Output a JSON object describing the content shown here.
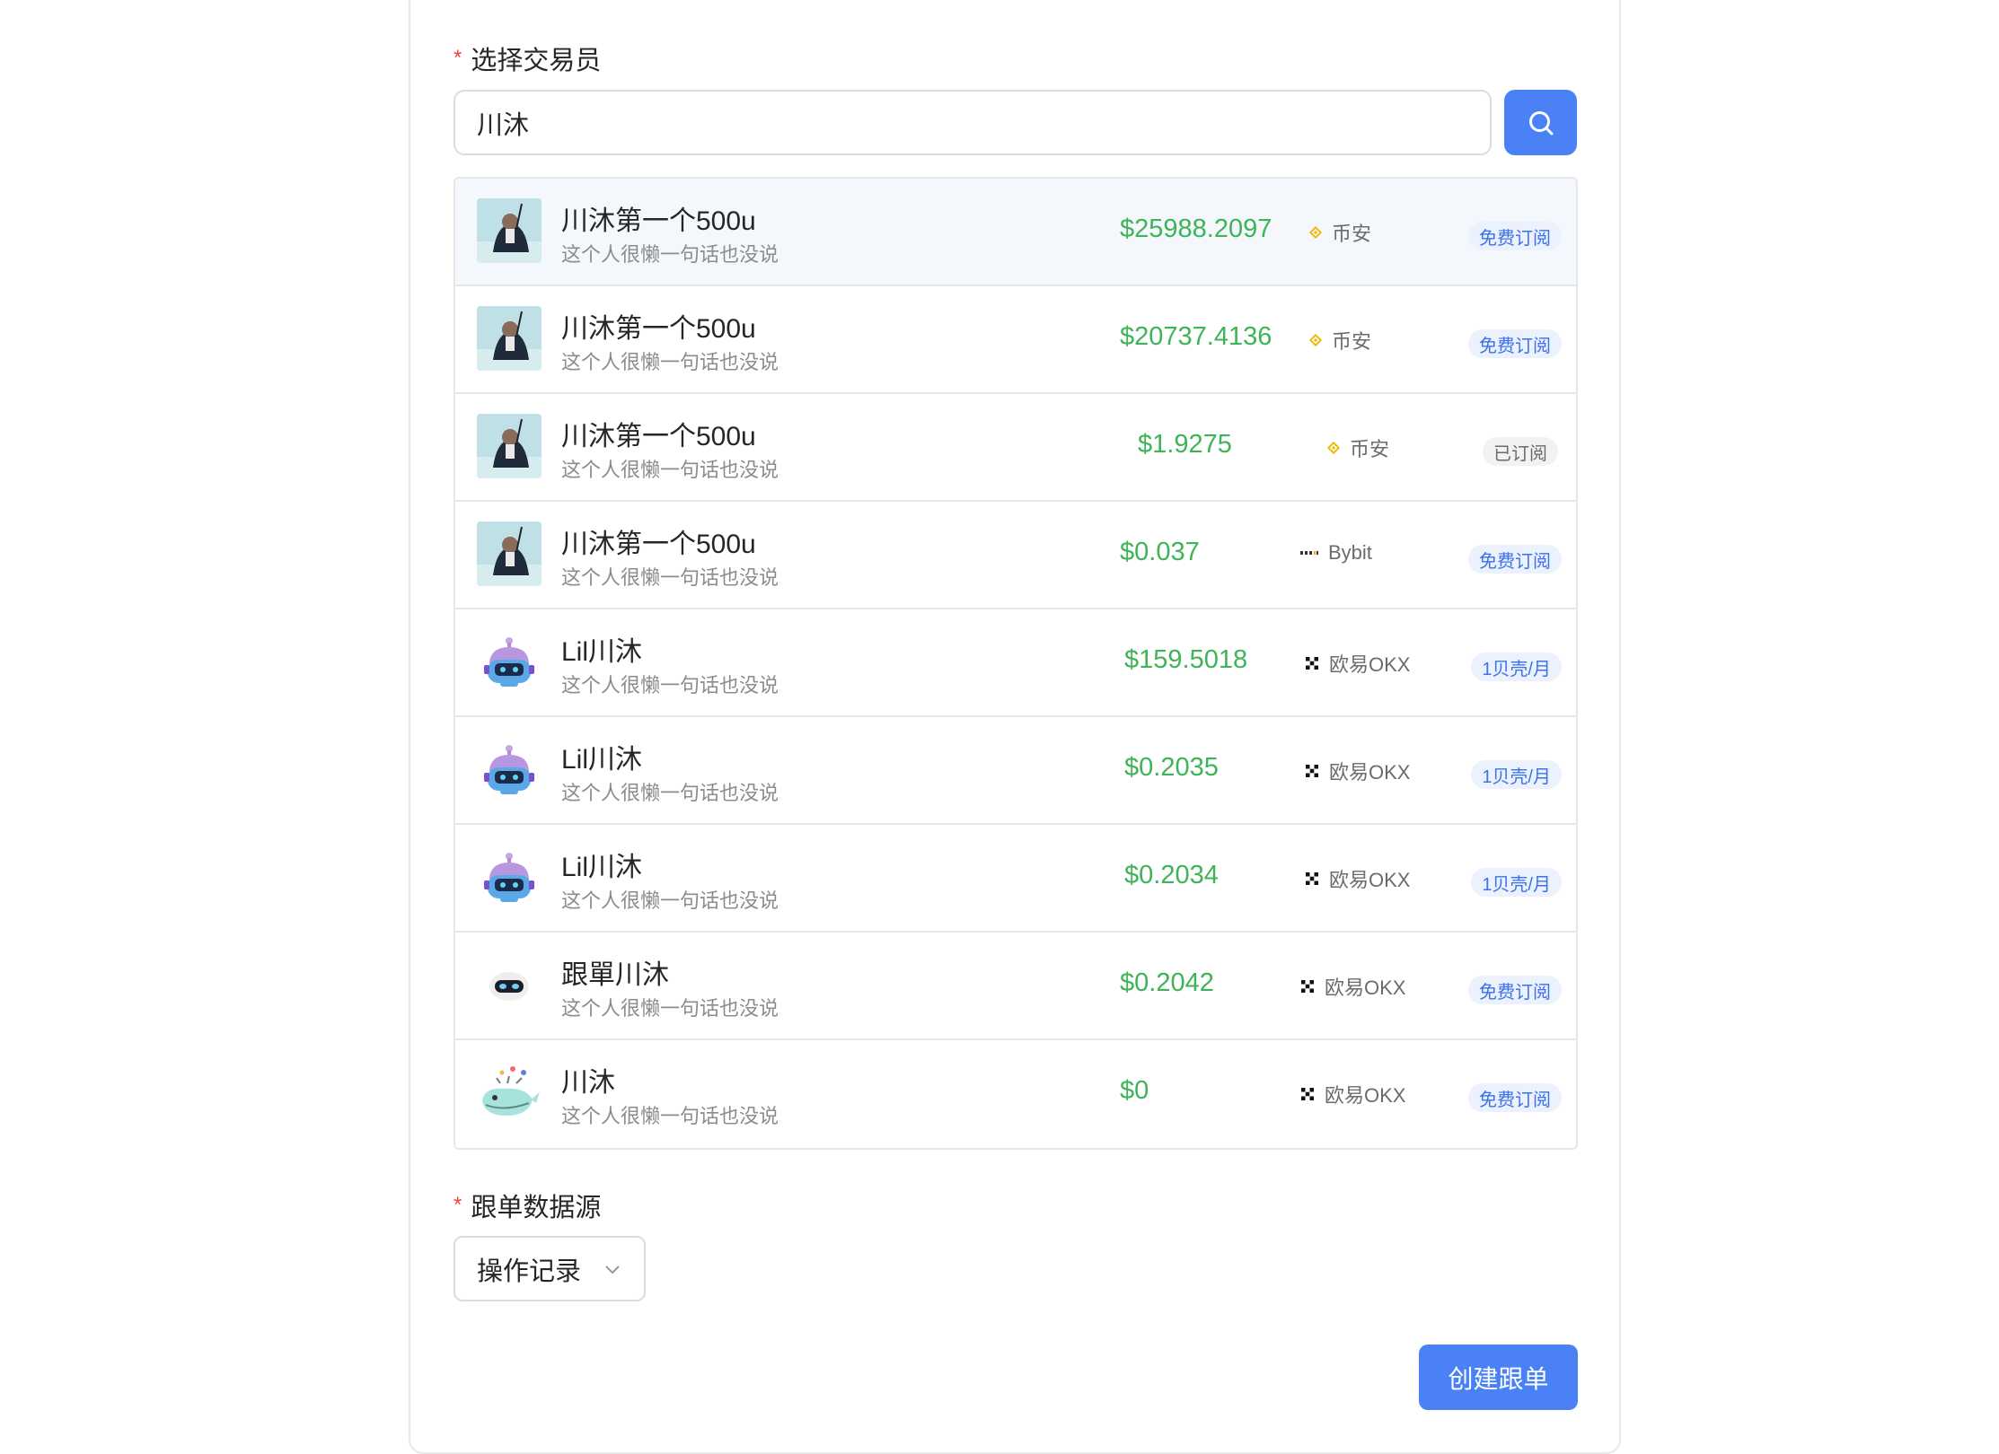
{
  "form": {
    "trader_label": "选择交易员",
    "required_mark": "*",
    "search_value": "川沐",
    "source_label": "跟单数据源",
    "source_selected": "操作记录",
    "create_label": "创建跟单"
  },
  "traders": [
    {
      "name": "川沐第一个500u",
      "desc": "这个人很懒一句话也没说",
      "amount": "$25988.2097",
      "exchange": "币安",
      "exchange_icon": "binance-icon",
      "badge": "免费订阅",
      "badge_type": "blue",
      "avatar": "photo-avatar"
    },
    {
      "name": "川沐第一个500u",
      "desc": "这个人很懒一句话也没说",
      "amount": "$20737.4136",
      "exchange": "币安",
      "exchange_icon": "binance-icon",
      "badge": "免费订阅",
      "badge_type": "blue",
      "avatar": "photo-avatar"
    },
    {
      "name": "川沐第一个500u",
      "desc": "这个人很懒一句话也没说",
      "amount": "$1.9275",
      "exchange": "币安",
      "exchange_icon": "binance-icon",
      "badge": "已订阅",
      "badge_type": "gray",
      "avatar": "photo-avatar"
    },
    {
      "name": "川沐第一个500u",
      "desc": "这个人很懒一句话也没说",
      "amount": "$0.037",
      "exchange": "Bybit",
      "exchange_icon": "bybit-icon",
      "badge": "免费订阅",
      "badge_type": "blue",
      "avatar": "photo-avatar"
    },
    {
      "name": "Lil川沐",
      "desc": "这个人很懒一句话也没说",
      "amount": "$159.5018",
      "exchange": "欧易OKX",
      "exchange_icon": "okx-icon",
      "badge": "1贝壳/月",
      "badge_type": "blue",
      "avatar": "robot-avatar"
    },
    {
      "name": "Lil川沐",
      "desc": "这个人很懒一句话也没说",
      "amount": "$0.2035",
      "exchange": "欧易OKX",
      "exchange_icon": "okx-icon",
      "badge": "1贝壳/月",
      "badge_type": "blue",
      "avatar": "robot-avatar"
    },
    {
      "name": "Lil川沐",
      "desc": "这个人很懒一句话也没说",
      "amount": "$0.2034",
      "exchange": "欧易OKX",
      "exchange_icon": "okx-icon",
      "badge": "1贝壳/月",
      "badge_type": "blue",
      "avatar": "robot-avatar"
    },
    {
      "name": "跟單川沐",
      "desc": "这个人很懒一句话也没说",
      "amount": "$0.2042",
      "exchange": "欧易OKX",
      "exchange_icon": "okx-icon",
      "badge": "免费订阅",
      "badge_type": "blue",
      "avatar": "bot-head-avatar"
    },
    {
      "name": "川沐",
      "desc": "这个人很懒一句话也没说",
      "amount": "$0",
      "exchange": "欧易OKX",
      "exchange_icon": "okx-icon",
      "badge": "免费订阅",
      "badge_type": "blue",
      "avatar": "whale-avatar"
    }
  ],
  "colors": {
    "accent": "#4a82f5",
    "amount_green": "#3fb357",
    "badge_blue_bg": "#ecf2fd",
    "badge_blue_text": "#3d72e8",
    "required_red": "#e8453c",
    "binance_yellow": "#f0b90b"
  }
}
